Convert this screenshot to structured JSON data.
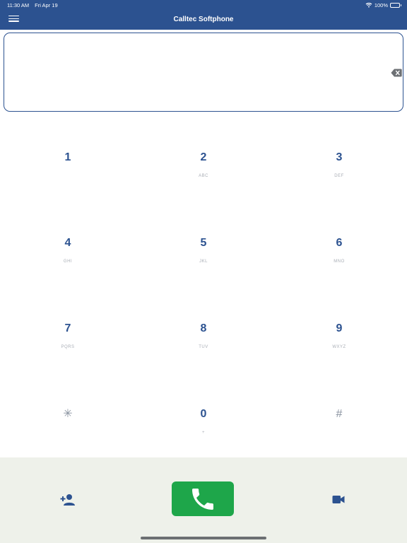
{
  "status_bar": {
    "time": "11:30 AM",
    "date": "Fri Apr 19",
    "battery": "100%",
    "battery_level": 1.0,
    "icons": [
      "wifi-icon",
      "battery-icon"
    ]
  },
  "header": {
    "title": "Calltec Softphone",
    "menu_icon": "hamburger-menu-icon"
  },
  "dialer": {
    "number": "",
    "backspace_icon": "backspace-icon"
  },
  "keypad": {
    "keys": [
      {
        "digit": "1",
        "letters": ""
      },
      {
        "digit": "2",
        "letters": "ABC"
      },
      {
        "digit": "3",
        "letters": "DEF"
      },
      {
        "digit": "4",
        "letters": "GHI"
      },
      {
        "digit": "5",
        "letters": "JKL"
      },
      {
        "digit": "6",
        "letters": "MNO"
      },
      {
        "digit": "7",
        "letters": "PQRS"
      },
      {
        "digit": "8",
        "letters": "TUV"
      },
      {
        "digit": "9",
        "letters": "WXYZ"
      },
      {
        "digit": "✳",
        "letters": ""
      },
      {
        "digit": "0",
        "letters": "+"
      },
      {
        "digit": "#",
        "letters": ""
      }
    ]
  },
  "actions": {
    "add_contact_icon": "add-contact-icon",
    "call_icon": "phone-icon",
    "video_icon": "video-camera-icon"
  },
  "colors": {
    "brand": "#2c5290",
    "call": "#1ea64a",
    "bottom_bar": "#eef1ea"
  }
}
